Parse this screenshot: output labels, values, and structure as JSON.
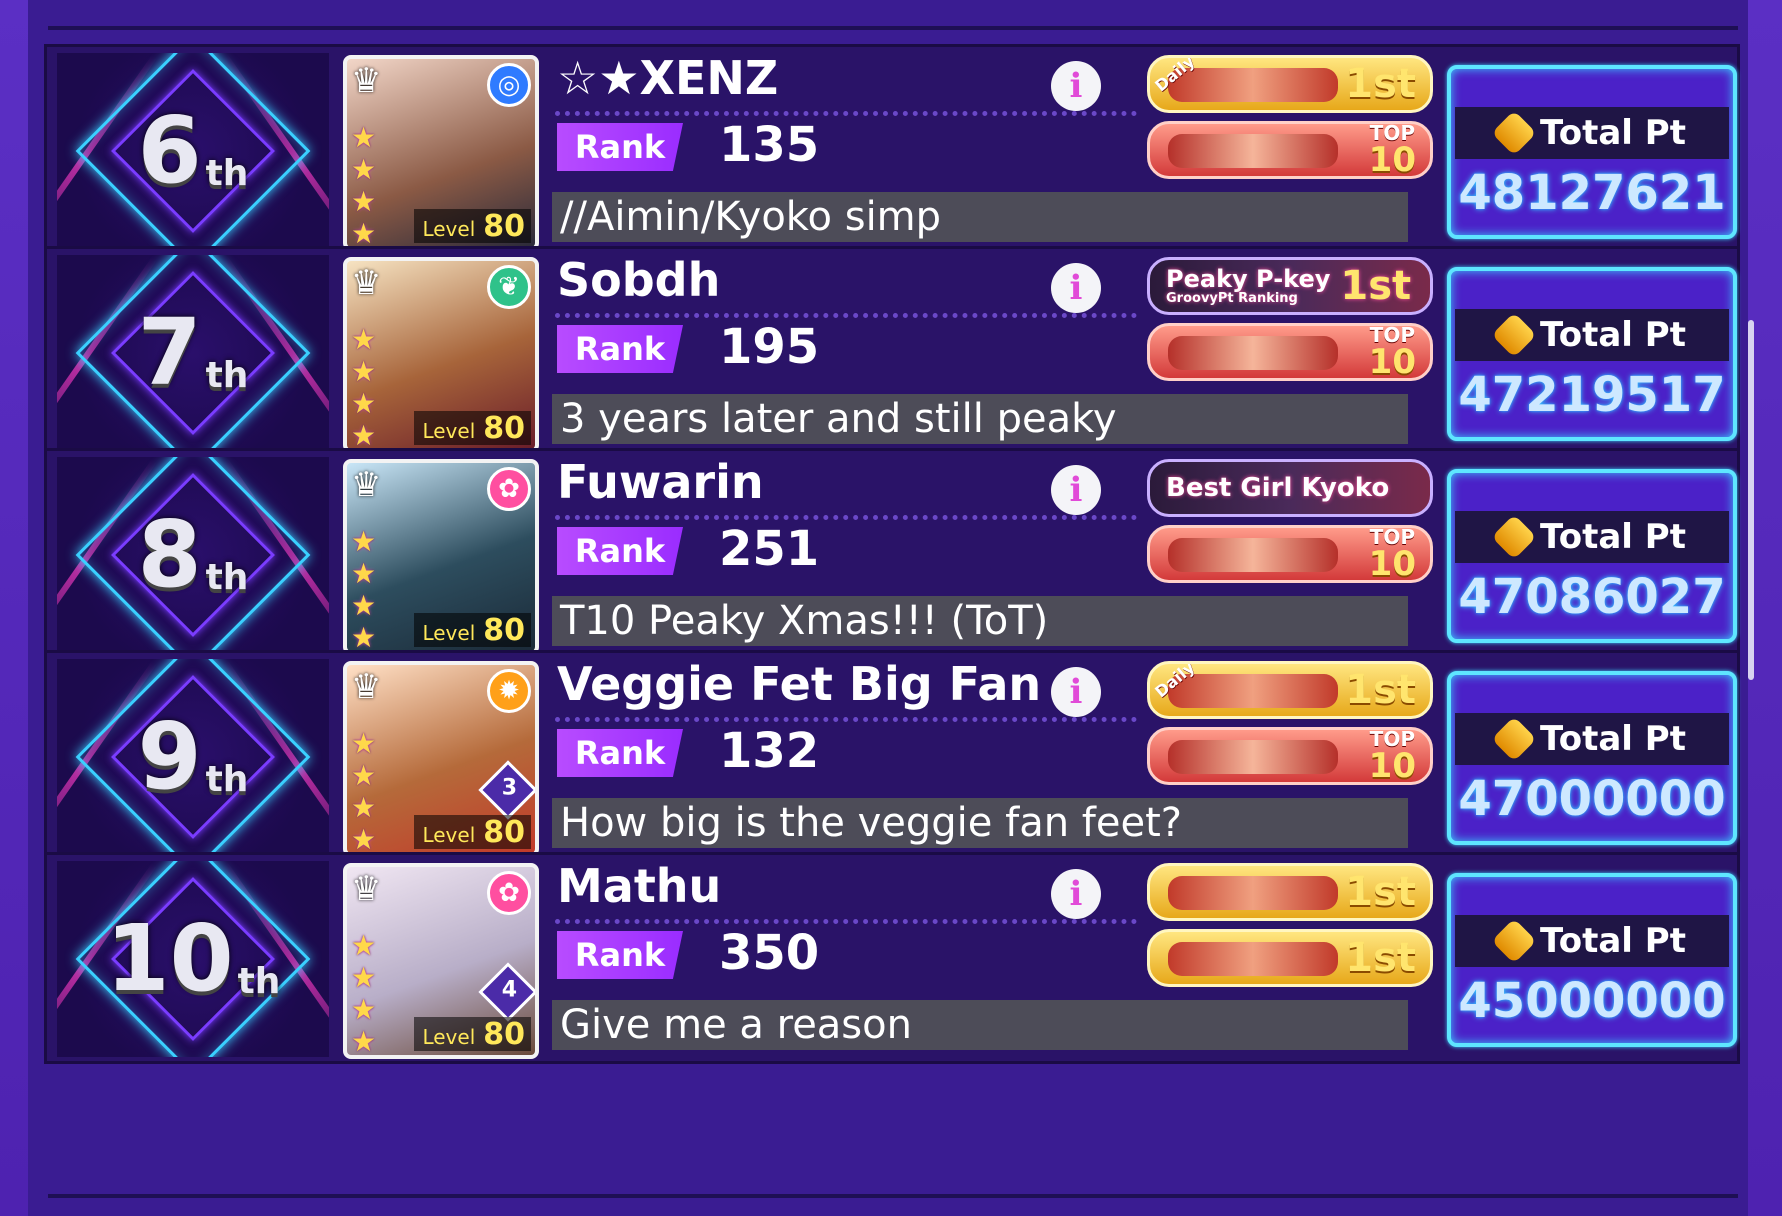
{
  "colors": {
    "background": "#4e22b0",
    "row_background": "#2a1368",
    "accent_cyan": "#5ee6ff",
    "rank_badge": "#a63cff",
    "comment_bar": "#4d4c58"
  },
  "labels": {
    "rank": "Rank",
    "total_pt": "Total Pt",
    "level": "Level"
  },
  "rows": [
    {
      "place": "6",
      "suffix": "th",
      "name": "☆★XENZ",
      "rank": "135",
      "comment": "//Aimin/Kyoko simp",
      "total_pt": "48127621",
      "level": "80",
      "attribute_icon": "cool-icon",
      "badges": [
        {
          "style": "gold",
          "text": "1st",
          "corner": "Daily"
        },
        {
          "style": "pink",
          "top": "TOP",
          "num": "10"
        }
      ]
    },
    {
      "place": "7",
      "suffix": "th",
      "name": "Sobdh",
      "rank": "195",
      "comment": "3 years later and still peaky",
      "total_pt": "47219517",
      "level": "80",
      "attribute_icon": "pure-icon",
      "badges": [
        {
          "style": "dark",
          "text": "Peaky P-key",
          "sub": "GroovyPt Ranking",
          "place": "1st"
        },
        {
          "style": "pink",
          "top": "TOP",
          "num": "10"
        }
      ]
    },
    {
      "place": "8",
      "suffix": "th",
      "name": "Fuwarin",
      "rank": "251",
      "comment": "T10 Peaky Xmas!!! (ToT)",
      "total_pt": "47086027",
      "level": "80",
      "attribute_icon": "happy-icon",
      "badges": [
        {
          "style": "dark",
          "text": "Best Girl Kyoko"
        },
        {
          "style": "pink",
          "top": "TOP",
          "num": "10"
        }
      ]
    },
    {
      "place": "9",
      "suffix": "th",
      "name": "Veggie Fet Big Fan",
      "rank": "132",
      "comment": "How big is the veggie fan feet?",
      "total_pt": "47000000",
      "level": "80",
      "training": "3",
      "attribute_icon": "powerful-icon",
      "badges": [
        {
          "style": "gold",
          "text": "1st",
          "corner": "Daily"
        },
        {
          "style": "pink",
          "top": "TOP",
          "num": "10"
        }
      ]
    },
    {
      "place": "10",
      "suffix": "th",
      "name": "Mathu",
      "rank": "350",
      "comment": "Give me a reason",
      "total_pt": "45000000",
      "level": "80",
      "training": "4",
      "attribute_icon": "happy-icon",
      "badges": [
        {
          "style": "gold",
          "text": "1st"
        },
        {
          "style": "gold",
          "text": "1st"
        }
      ]
    }
  ]
}
